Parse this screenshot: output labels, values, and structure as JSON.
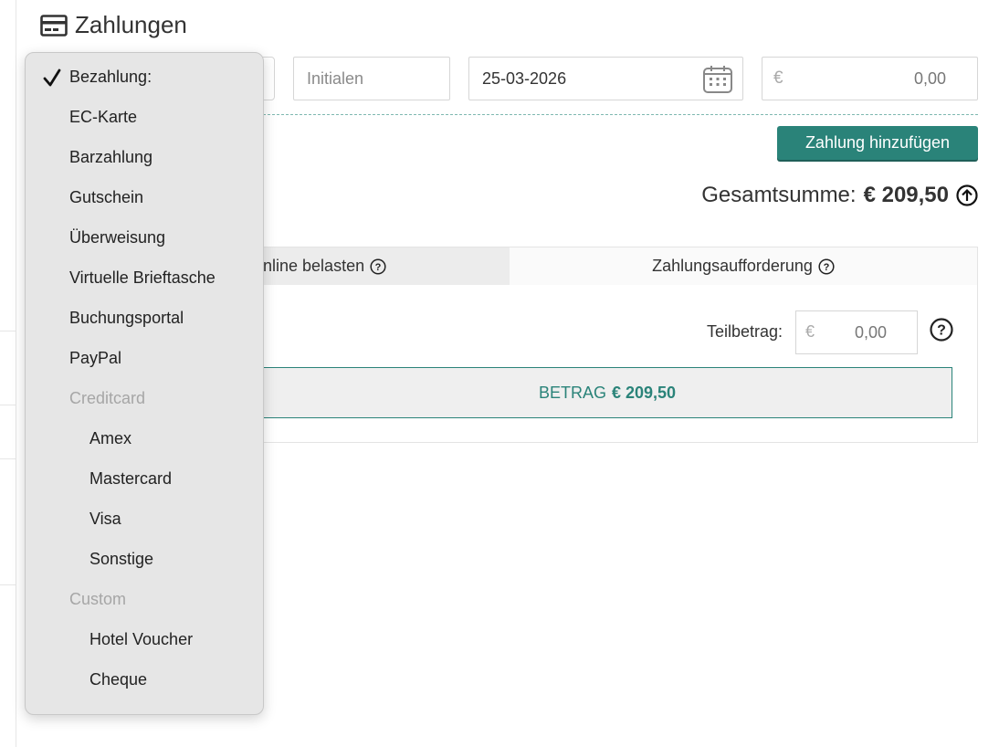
{
  "page": {
    "title": "Zahlungen"
  },
  "form": {
    "initials_placeholder": "Initialen",
    "date_value": "25-03-2026",
    "currency_symbol": "€",
    "amount_value": "0,00",
    "add_button_label": "Zahlung hinzufügen"
  },
  "total": {
    "label": "Gesamtsumme:",
    "amount": "€ 209,50"
  },
  "tabs": [
    {
      "label": "nline belasten"
    },
    {
      "label": "Zahlungsaufforderung"
    }
  ],
  "partial": {
    "label": "Teilbetrag:",
    "currency_symbol": "€",
    "value": "0,00"
  },
  "charge_button": {
    "prefix": "BETRAG",
    "amount": "€ 209,50"
  },
  "payment_dropdown": {
    "selected": "Bezahlung:",
    "options": [
      {
        "label": "Bezahlung:",
        "type": "option",
        "indent": 0
      },
      {
        "label": "EC-Karte",
        "type": "option",
        "indent": 0
      },
      {
        "label": "Barzahlung",
        "type": "option",
        "indent": 0
      },
      {
        "label": "Gutschein",
        "type": "option",
        "indent": 0
      },
      {
        "label": "Überweisung",
        "type": "option",
        "indent": 0
      },
      {
        "label": "Virtuelle Brieftasche",
        "type": "option",
        "indent": 0
      },
      {
        "label": "Buchungsportal",
        "type": "option",
        "indent": 0
      },
      {
        "label": "PayPal",
        "type": "option",
        "indent": 0
      },
      {
        "label": "Creditcard",
        "type": "group",
        "indent": 0
      },
      {
        "label": "Amex",
        "type": "option",
        "indent": 1
      },
      {
        "label": "Mastercard",
        "type": "option",
        "indent": 1
      },
      {
        "label": "Visa",
        "type": "option",
        "indent": 1
      },
      {
        "label": "Sonstige",
        "type": "option",
        "indent": 1
      },
      {
        "label": "Custom",
        "type": "group",
        "indent": 0
      },
      {
        "label": "Hotel Voucher",
        "type": "option",
        "indent": 1
      },
      {
        "label": "Cheque",
        "type": "option",
        "indent": 1
      }
    ]
  },
  "colors": {
    "accent": "#2a8379",
    "dropdown_bg": "#e6e6e6",
    "group_label": "#a6a6a6"
  }
}
